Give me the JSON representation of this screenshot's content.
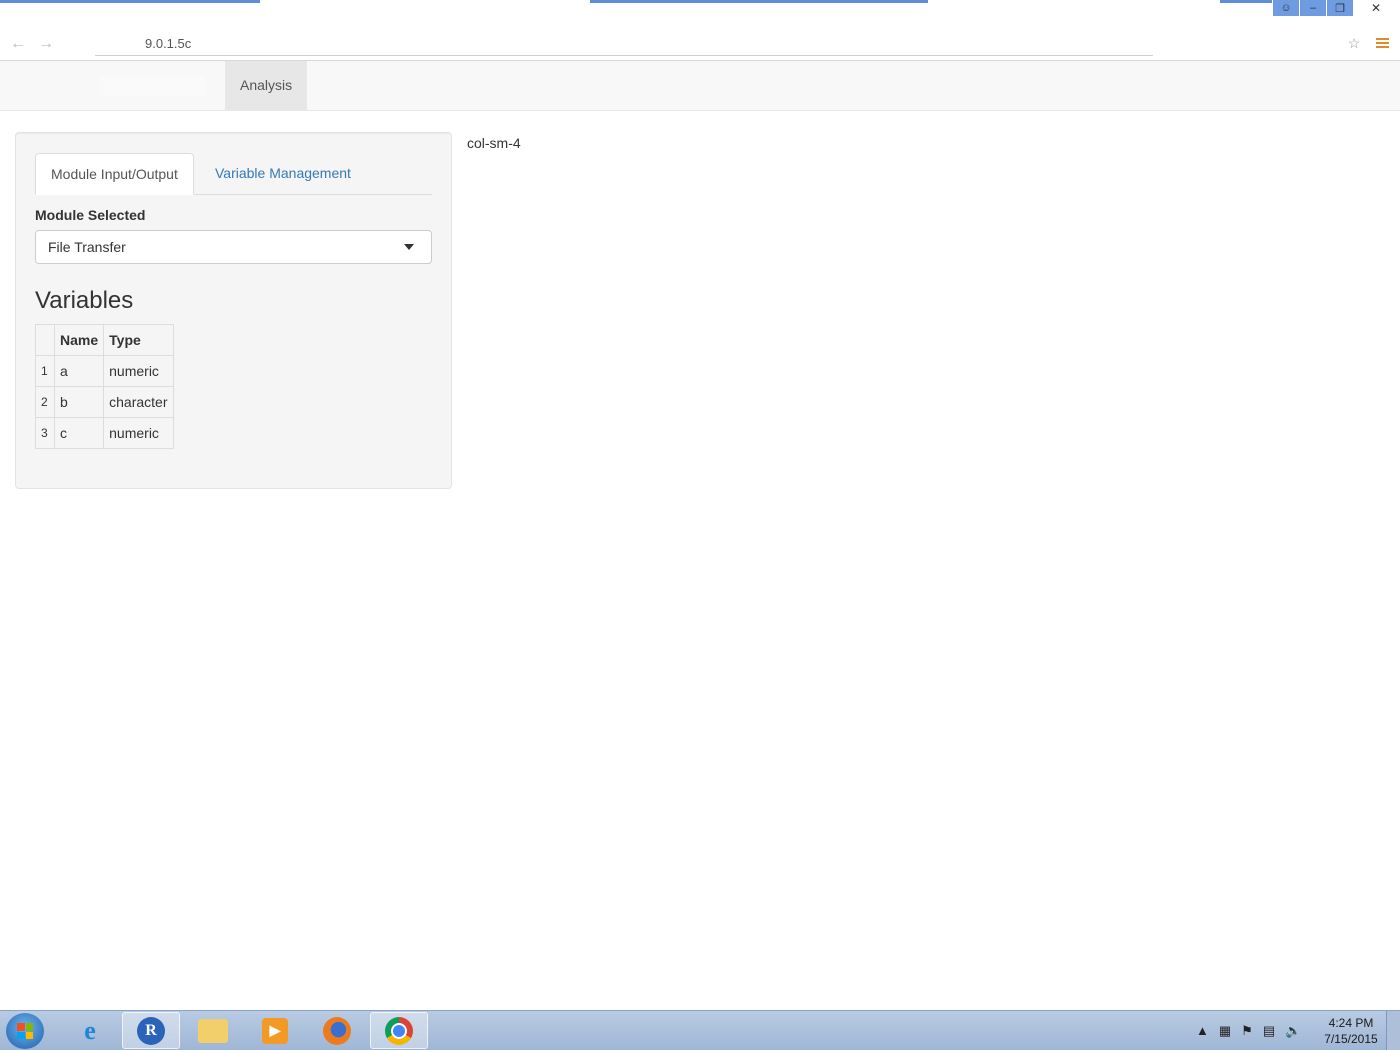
{
  "browser": {
    "url_text": "9.0.1.5c"
  },
  "navbar": {
    "tab_label": "Analysis"
  },
  "sidebar": {
    "tabs": [
      {
        "label": "Module Input/Output",
        "active": true
      },
      {
        "label": "Variable Management",
        "active": false
      }
    ],
    "module_label": "Module Selected",
    "module_value": "File Transfer",
    "variables_heading": "Variables",
    "table": {
      "headers": [
        "",
        "Name",
        "Type"
      ],
      "rows": [
        {
          "index": "1",
          "name": "a",
          "type": "numeric"
        },
        {
          "index": "2",
          "name": "b",
          "type": "character"
        },
        {
          "index": "3",
          "name": "c",
          "type": "numeric"
        }
      ]
    }
  },
  "main": {
    "placeholder_text": "col-sm-4"
  },
  "taskbar": {
    "apps": [
      "internet-explorer",
      "r",
      "file-explorer",
      "media-player",
      "firefox",
      "chrome"
    ],
    "time": "4:24 PM",
    "date": "7/15/2015"
  },
  "colors": {
    "link": "#337ab7",
    "well_bg": "#f5f5f5",
    "navbar_bg": "#f8f8f8",
    "taskbar": "#a9bedb"
  }
}
